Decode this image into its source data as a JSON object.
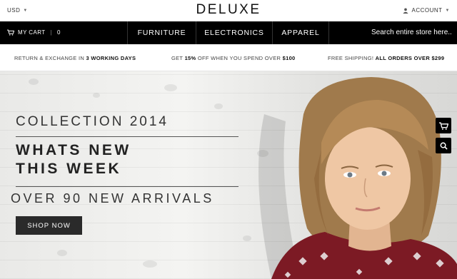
{
  "header": {
    "currency": "USD",
    "logo": "DELUXE",
    "account": "ACCOUNT"
  },
  "nav": {
    "cart_label": "MY CART",
    "cart_count": "0",
    "links": [
      "FURNITURE",
      "ELECTRONICS",
      "APPAREL"
    ],
    "search_placeholder": "Search entire store here..."
  },
  "promo": {
    "left_pre": "RETURN & EXCHANGE IN ",
    "left_bold": "3 WORKING DAYS",
    "mid_pre": "GET ",
    "mid_bold1": "15%",
    "mid_mid": " OFF WHEN YOU SPEND OVER ",
    "mid_bold2": "$100",
    "right_pre": "FREE SHIPPING! ",
    "right_bold": "ALL ORDERS OVER $299"
  },
  "hero": {
    "collection": "COLLECTION 2014",
    "headline_line1": "WHATS NEW",
    "headline_line2": "THIS WEEK",
    "arrivals": "OVER 90 NEW ARRIVALS",
    "cta": "SHOP NOW"
  },
  "side_buttons": [
    "cart-icon",
    "search-icon"
  ]
}
